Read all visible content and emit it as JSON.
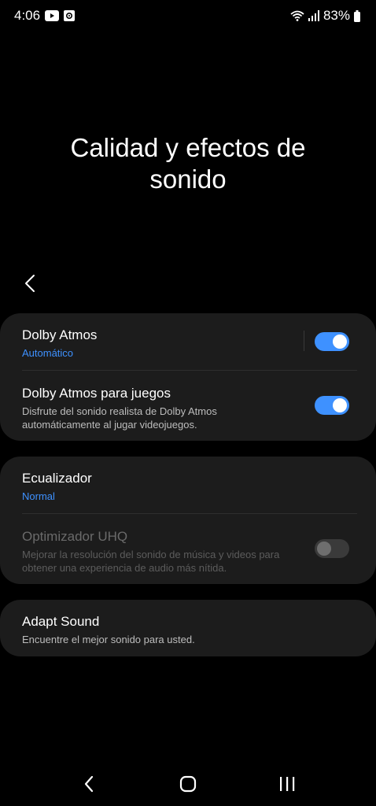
{
  "status_bar": {
    "time": "4:06",
    "battery": "83%",
    "icons": [
      "youtube-icon",
      "notification-icon",
      "wifi-icon",
      "signal-icon",
      "battery-icon"
    ]
  },
  "page": {
    "title": "Calidad y efectos de sonido"
  },
  "card1": {
    "dolby_atmos": {
      "title": "Dolby Atmos",
      "subtitle": "Automático",
      "enabled": true
    },
    "dolby_games": {
      "title": "Dolby Atmos para juegos",
      "subtitle": "Disfrute del sonido realista de Dolby Atmos automáticamente al jugar videojuegos.",
      "enabled": true
    }
  },
  "card2": {
    "equalizer": {
      "title": "Ecualizador",
      "subtitle": "Normal"
    },
    "uhq": {
      "title": "Optimizador UHQ",
      "subtitle": "Mejorar la resolución del sonido de música y videos para obtener una experiencia de audio más nítida.",
      "enabled": false
    }
  },
  "card3": {
    "adapt_sound": {
      "title": "Adapt Sound",
      "subtitle": "Encuentre el mejor sonido para usted."
    }
  },
  "colors": {
    "accent": "#3e91ff",
    "card_bg": "#1c1c1c",
    "background": "#000000"
  }
}
